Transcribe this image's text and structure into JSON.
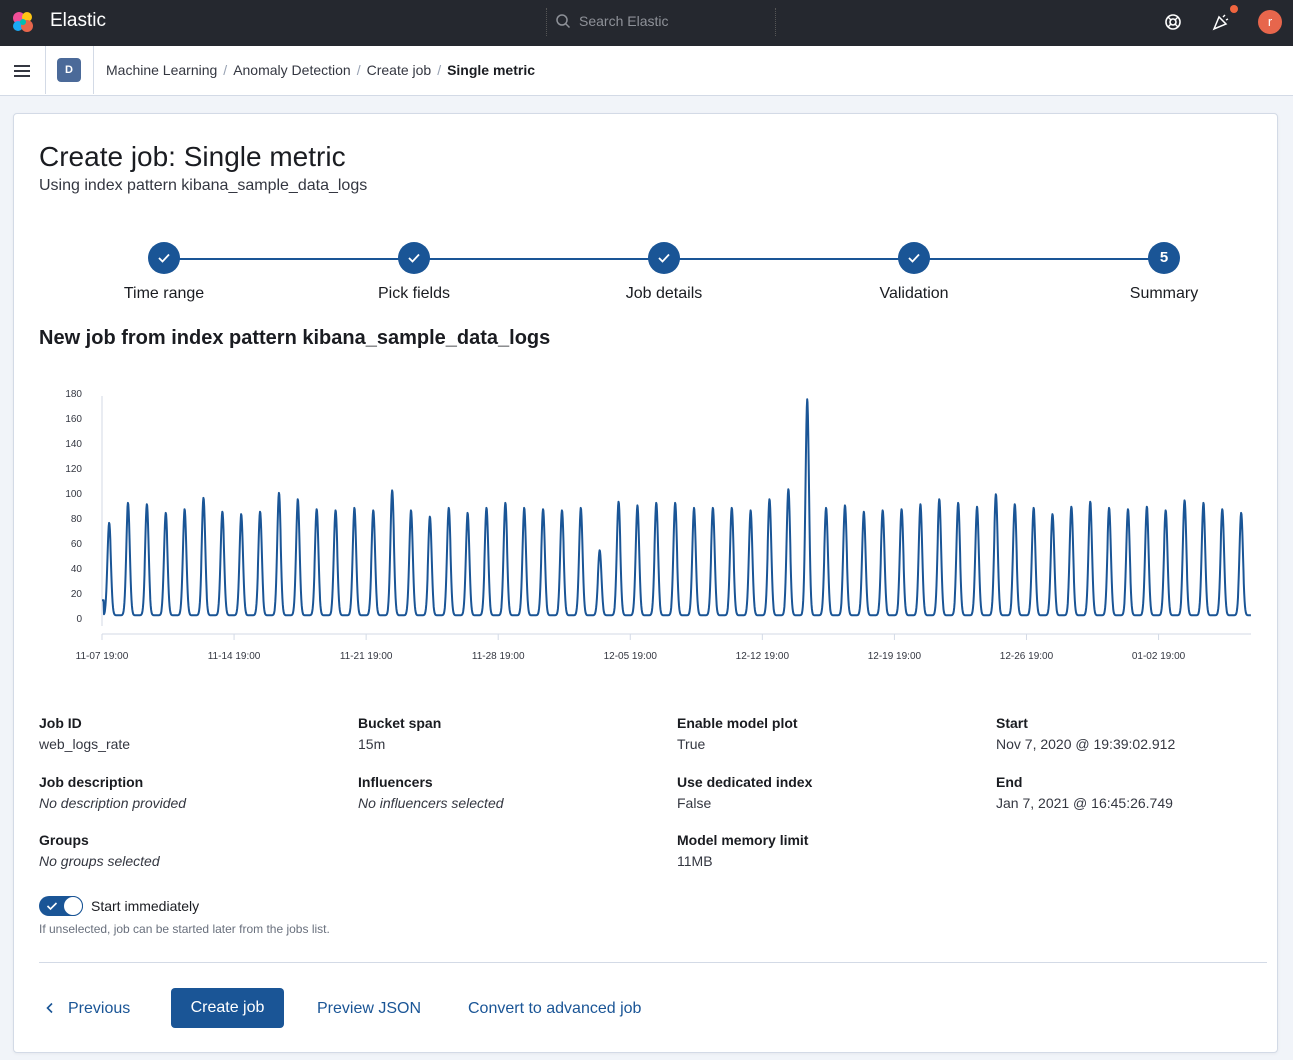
{
  "header": {
    "brand": "Elastic",
    "search_placeholder": "Search Elastic",
    "avatar_initial": "r"
  },
  "breadcrumb": {
    "space_initial": "D",
    "items": [
      "Machine Learning",
      "Anomaly Detection",
      "Create job"
    ],
    "current": "Single metric"
  },
  "page": {
    "title": "Create job: Single metric",
    "subtitle": "Using index pattern kibana_sample_data_logs"
  },
  "steps": [
    {
      "label": "Time range",
      "done": true
    },
    {
      "label": "Pick fields",
      "done": true
    },
    {
      "label": "Job details",
      "done": true
    },
    {
      "label": "Validation",
      "done": true
    },
    {
      "label": "Summary",
      "done": false,
      "number": "5"
    }
  ],
  "chart_title": "New job from index pattern kibana_sample_data_logs",
  "chart_data": {
    "type": "line",
    "ylim": [
      0,
      180
    ],
    "yticks": [
      0,
      20,
      40,
      60,
      80,
      100,
      120,
      140,
      160,
      180
    ],
    "xtick_labels": [
      "11-07 19:00",
      "11-14 19:00",
      "11-21 19:00",
      "11-28 19:00",
      "12-05 19:00",
      "12-12 19:00",
      "12-19 19:00",
      "12-26 19:00",
      "01-02 19:00"
    ],
    "x_range_days": [
      0,
      60.9
    ],
    "series": [
      {
        "color": "#1a5596",
        "daily_peaks": [
          77,
          93,
          92,
          85,
          88,
          97,
          86,
          84,
          86,
          101,
          96,
          88,
          87,
          89,
          87,
          103,
          87,
          82,
          89,
          85,
          89,
          93,
          89,
          88,
          87,
          89,
          55,
          94,
          91,
          93,
          93,
          89,
          89,
          89,
          87,
          96,
          104,
          176,
          89,
          91,
          86,
          87,
          88,
          92,
          96,
          93,
          90,
          100,
          92,
          89,
          84,
          90,
          94,
          89,
          88,
          90,
          87,
          95,
          93,
          88,
          85
        ]
      }
    ]
  },
  "summary": {
    "job_id_label": "Job ID",
    "job_id": "web_logs_rate",
    "job_desc_label": "Job description",
    "job_desc": "No description provided",
    "groups_label": "Groups",
    "groups": "No groups selected",
    "bucket_span_label": "Bucket span",
    "bucket_span": "15m",
    "influencers_label": "Influencers",
    "influencers": "No influencers selected",
    "model_plot_label": "Enable model plot",
    "model_plot": "True",
    "dedicated_index_label": "Use dedicated index",
    "dedicated_index": "False",
    "mml_label": "Model memory limit",
    "mml": "11MB",
    "start_label": "Start",
    "start": "Nov 7, 2020 @ 19:39:02.912",
    "end_label": "End",
    "end": "Jan 7, 2021 @ 16:45:26.749"
  },
  "start_immediately": {
    "label": "Start immediately",
    "checked": true,
    "help": "If unselected, job can be started later from the jobs list."
  },
  "actions": {
    "previous": "Previous",
    "create": "Create job",
    "preview": "Preview JSON",
    "convert": "Convert to advanced job"
  }
}
